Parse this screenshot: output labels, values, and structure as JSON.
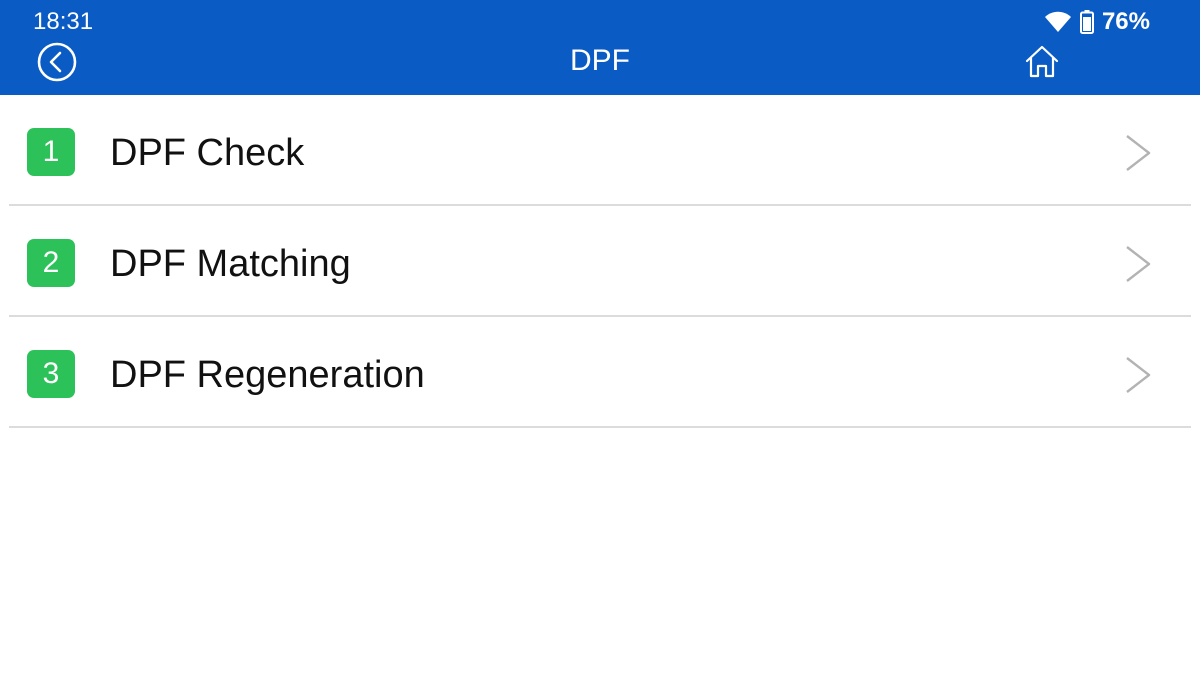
{
  "status_bar": {
    "time": "18:31",
    "battery_percent": "76%",
    "wifi_icon": "wifi-icon",
    "battery_icon": "battery-icon"
  },
  "header": {
    "title": "DPF",
    "back_icon": "circle-chevron-left-icon",
    "home_icon": "home-icon",
    "background_color": "#0b5bc5"
  },
  "menu": {
    "badge_color": "#2dc259",
    "items": [
      {
        "number": "1",
        "label": "DPF Check"
      },
      {
        "number": "2",
        "label": "DPF Matching"
      },
      {
        "number": "3",
        "label": "DPF Regeneration"
      }
    ]
  }
}
